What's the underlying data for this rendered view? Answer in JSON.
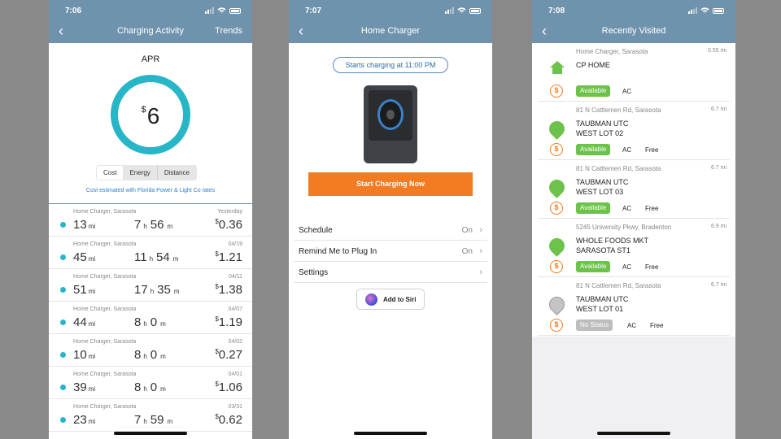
{
  "colors": {
    "navbar": "#6f93ad",
    "teal": "#27b6c8",
    "orange": "#f37b21",
    "available": "#6cc24a",
    "link": "#2d7fd0"
  },
  "activity": {
    "status_time": "7:06",
    "title": "Charging Activity",
    "trends_label": "Trends",
    "month": "APR",
    "total_currency": "$",
    "total_amount": "6",
    "tabs": [
      "Cost",
      "Energy",
      "Distance"
    ],
    "rates_note": "Cost estimated with Florida Power & Light Co rates",
    "sessions": [
      {
        "location": "Home Charger, Sarasota",
        "date": "Yesterday",
        "miles": "13",
        "hours": "7",
        "minutes": "56",
        "cost": "0.36"
      },
      {
        "location": "Home Charger, Sarasota",
        "date": "04/19",
        "miles": "45",
        "hours": "11",
        "minutes": "54",
        "cost": "1.21"
      },
      {
        "location": "Home Charger, Sarasota",
        "date": "04/11",
        "miles": "51",
        "hours": "17",
        "minutes": "35",
        "cost": "1.38"
      },
      {
        "location": "Home Charger, Sarasota",
        "date": "04/07",
        "miles": "44",
        "hours": "8",
        "minutes": "0",
        "cost": "1.19"
      },
      {
        "location": "Home Charger, Sarasota",
        "date": "04/02",
        "miles": "10",
        "hours": "8",
        "minutes": "0",
        "cost": "0.27"
      },
      {
        "location": "Home Charger, Sarasota",
        "date": "04/01",
        "miles": "39",
        "hours": "8",
        "minutes": "0",
        "cost": "1.06"
      },
      {
        "location": "Home Charger, Sarasota",
        "date": "03/31",
        "miles": "23",
        "hours": "7",
        "minutes": "59",
        "cost": "0.62"
      }
    ],
    "unit_mi": "mi",
    "unit_h": "h",
    "unit_m": "m",
    "cost_currency": "$"
  },
  "home": {
    "status_time": "7:07",
    "title": "Home Charger",
    "schedule_chip": "Starts charging at 11:00 PM",
    "start_button": "Start Charging Now",
    "charger_brand": "chargepoint",
    "settings_rows": [
      {
        "label": "Schedule",
        "value": "On"
      },
      {
        "label": "Remind Me to Plug In",
        "value": "On"
      },
      {
        "label": "Settings",
        "value": ""
      }
    ],
    "siri_label": "Add to Siri"
  },
  "recent": {
    "status_time": "7:08",
    "title": "Recently Visited",
    "locations": [
      {
        "address": "Home Charger, Sarasota",
        "distance": "0.55 mi",
        "name_line1": "CP HOME",
        "name_line2": "",
        "status": "Available",
        "type": "AC",
        "price": "",
        "icon": "house-icon"
      },
      {
        "address": "81 N Cattlemen Rd, Sarasota",
        "distance": "6.7 mi",
        "name_line1": "TAUBMAN UTC",
        "name_line2": "WEST LOT 02",
        "status": "Available",
        "type": "AC",
        "price": "Free",
        "icon": "pin-icon"
      },
      {
        "address": "81 N Cattlemen Rd, Sarasota",
        "distance": "6.7 mi",
        "name_line1": "TAUBMAN UTC",
        "name_line2": "WEST LOT 03",
        "status": "Available",
        "type": "AC",
        "price": "Free",
        "icon": "pin-icon"
      },
      {
        "address": "5245 University Pkwy, Bradenton",
        "distance": "6.9 mi",
        "name_line1": "WHOLE FOODS MKT",
        "name_line2": "SARASOTA ST1",
        "status": "Available",
        "type": "AC",
        "price": "Free",
        "icon": "pin-icon"
      },
      {
        "address": "81 N Cattlemen Rd, Sarasota",
        "distance": "6.7 mi",
        "name_line1": "TAUBMAN UTC",
        "name_line2": "WEST LOT 01",
        "status": "No Status",
        "type": "AC",
        "price": "Free",
        "icon": "pin-gray-icon"
      }
    ]
  }
}
